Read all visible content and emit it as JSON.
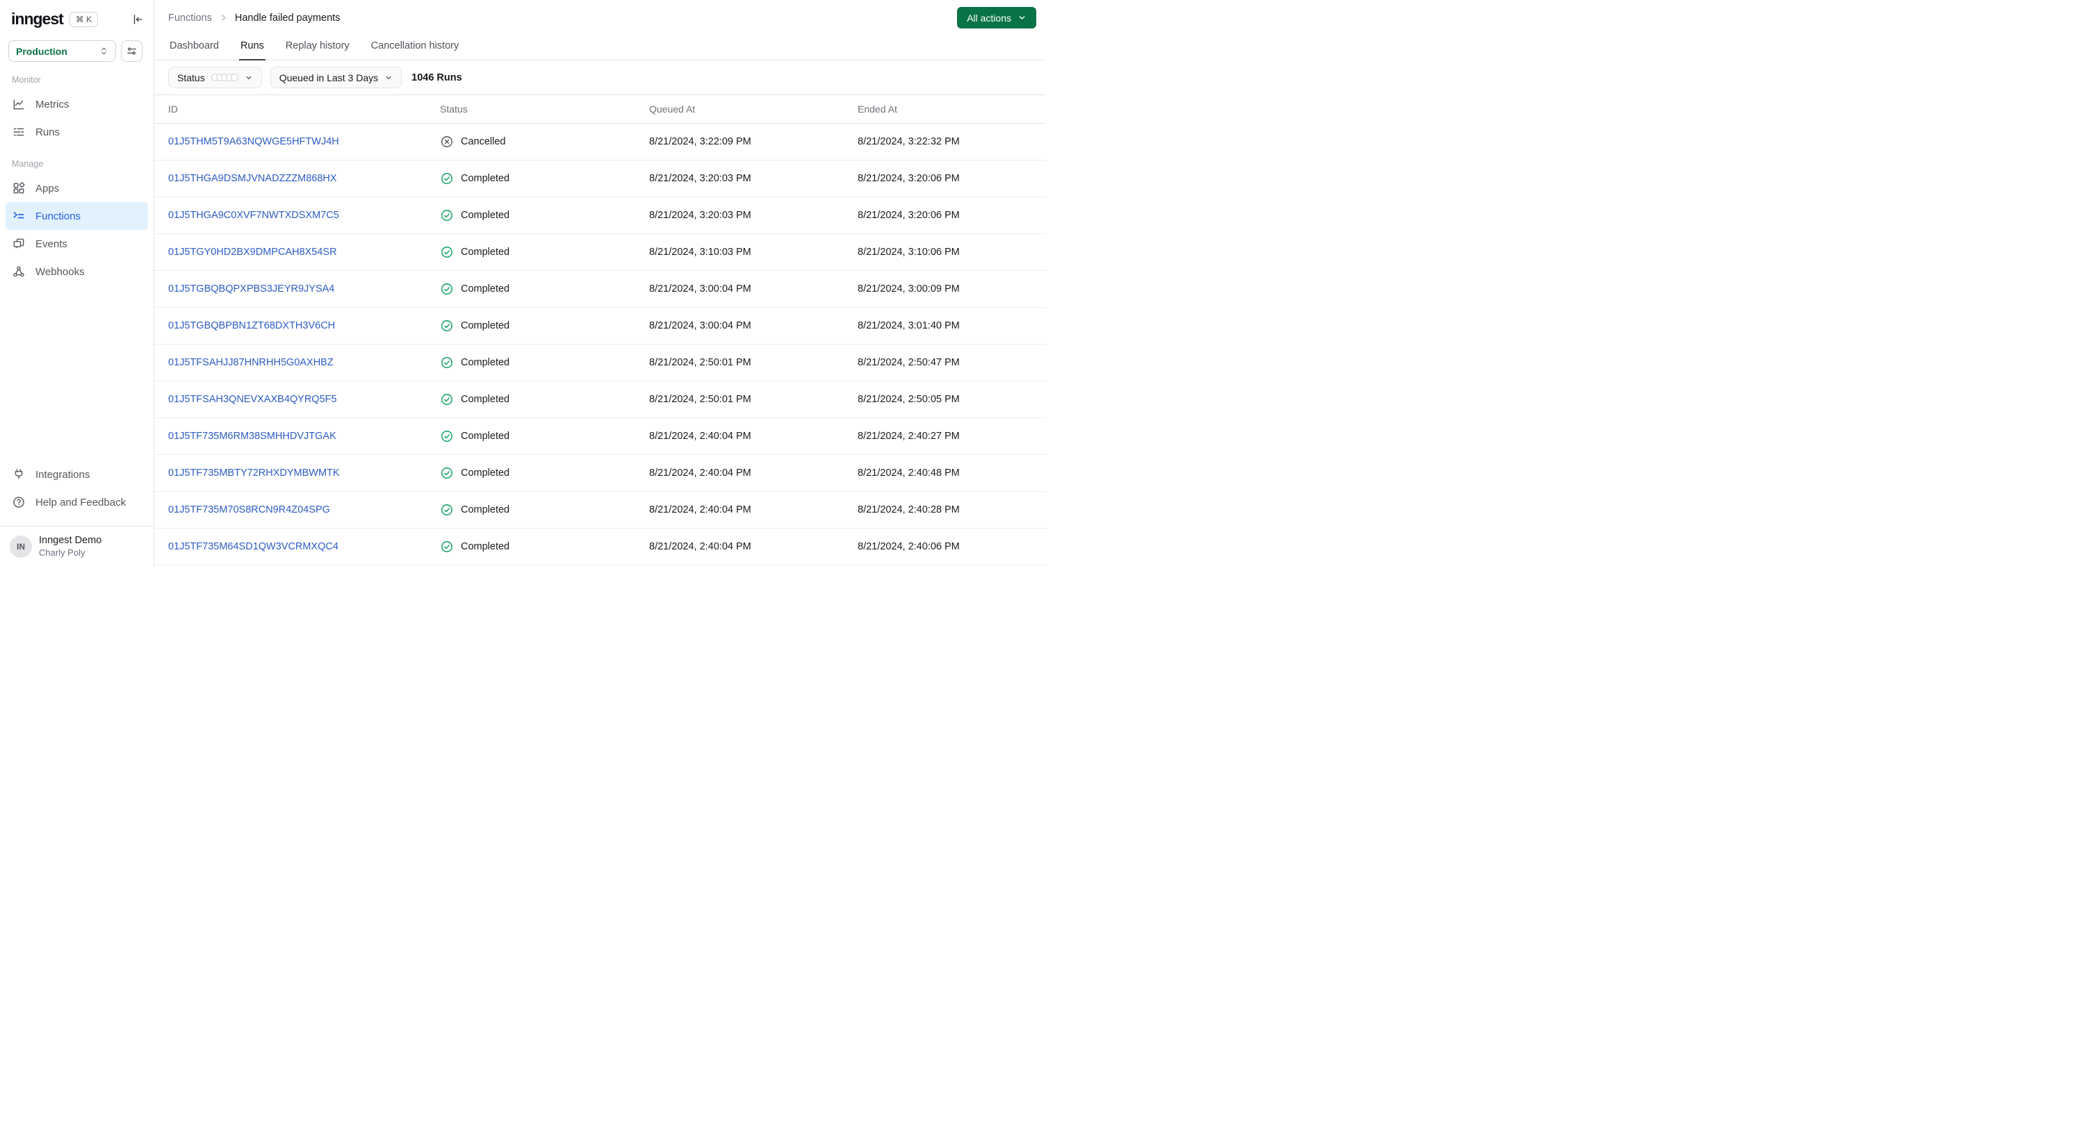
{
  "colors": {
    "accent_green": "#0a7346",
    "completed_green": "#0aa05c",
    "link_blue": "#2c5cc5",
    "active_nav_blue": "#2361dd",
    "active_nav_bg": "#e1f1fe",
    "border": "#e4e4e7"
  },
  "sidebar": {
    "logo": "inngest",
    "shortcut": "⌘ K",
    "collapse_icon": "collapse-sidebar-icon",
    "workspace": {
      "selected": "Production",
      "picker_icon": "updown-chevrons-icon",
      "settings_icon": "preferences-sliders-icon"
    },
    "sections": [
      {
        "label": "Monitor",
        "items": [
          {
            "label": "Metrics",
            "icon": "chart-icon",
            "active": false
          },
          {
            "label": "Runs",
            "icon": "dashed-list-icon",
            "active": false
          }
        ]
      },
      {
        "label": "Manage",
        "items": [
          {
            "label": "Apps",
            "icon": "apps-grid-icon",
            "active": false
          },
          {
            "label": "Functions",
            "icon": "function-list-icon",
            "active": true
          },
          {
            "label": "Events",
            "icon": "windows-icon",
            "active": false
          },
          {
            "label": "Webhooks",
            "icon": "webhook-icon",
            "active": false
          }
        ]
      }
    ],
    "footer_items": [
      {
        "label": "Integrations",
        "icon": "plug-icon"
      },
      {
        "label": "Help and Feedback",
        "icon": "question-circle-icon"
      }
    ],
    "user": {
      "initials": "IN",
      "org": "Inngest Demo",
      "name": "Charly Poly"
    }
  },
  "header": {
    "breadcrumb": {
      "root": "Functions",
      "current": "Handle failed payments"
    },
    "actions_button": "All actions",
    "tabs": [
      {
        "label": "Dashboard",
        "active": false
      },
      {
        "label": "Runs",
        "active": true
      },
      {
        "label": "Replay history",
        "active": false
      },
      {
        "label": "Cancellation history",
        "active": false
      }
    ]
  },
  "filters": {
    "status_label": "Status",
    "time_range": "Queued in Last 3 Days",
    "count": "1046 Runs"
  },
  "table": {
    "columns": [
      "ID",
      "Status",
      "Queued At",
      "Ended At"
    ],
    "rows": [
      {
        "id": "01J5THM5T9A63NQWGE5HFTWJ4H",
        "status": "cancelled",
        "status_label": "Cancelled",
        "queued_at": "8/21/2024, 3:22:09 PM",
        "ended_at": "8/21/2024, 3:22:32 PM"
      },
      {
        "id": "01J5THGA9DSMJVNADZZZM868HX",
        "status": "completed",
        "status_label": "Completed",
        "queued_at": "8/21/2024, 3:20:03 PM",
        "ended_at": "8/21/2024, 3:20:06 PM"
      },
      {
        "id": "01J5THGA9C0XVF7NWTXDSXM7C5",
        "status": "completed",
        "status_label": "Completed",
        "queued_at": "8/21/2024, 3:20:03 PM",
        "ended_at": "8/21/2024, 3:20:06 PM"
      },
      {
        "id": "01J5TGY0HD2BX9DMPCAH8X54SR",
        "status": "completed",
        "status_label": "Completed",
        "queued_at": "8/21/2024, 3:10:03 PM",
        "ended_at": "8/21/2024, 3:10:06 PM"
      },
      {
        "id": "01J5TGBQBQPXPBS3JEYR9JYSA4",
        "status": "completed",
        "status_label": "Completed",
        "queued_at": "8/21/2024, 3:00:04 PM",
        "ended_at": "8/21/2024, 3:00:09 PM"
      },
      {
        "id": "01J5TGBQBPBN1ZT68DXTH3V6CH",
        "status": "completed",
        "status_label": "Completed",
        "queued_at": "8/21/2024, 3:00:04 PM",
        "ended_at": "8/21/2024, 3:01:40 PM"
      },
      {
        "id": "01J5TFSAHJJ87HNRHH5G0AXHBZ",
        "status": "completed",
        "status_label": "Completed",
        "queued_at": "8/21/2024, 2:50:01 PM",
        "ended_at": "8/21/2024, 2:50:47 PM"
      },
      {
        "id": "01J5TFSAH3QNEVXAXB4QYRQ5F5",
        "status": "completed",
        "status_label": "Completed",
        "queued_at": "8/21/2024, 2:50:01 PM",
        "ended_at": "8/21/2024, 2:50:05 PM"
      },
      {
        "id": "01J5TF735M6RM38SMHHDVJTGAK",
        "status": "completed",
        "status_label": "Completed",
        "queued_at": "8/21/2024, 2:40:04 PM",
        "ended_at": "8/21/2024, 2:40:27 PM"
      },
      {
        "id": "01J5TF735MBTY72RHXDYMBWMTK",
        "status": "completed",
        "status_label": "Completed",
        "queued_at": "8/21/2024, 2:40:04 PM",
        "ended_at": "8/21/2024, 2:40:48 PM"
      },
      {
        "id": "01J5TF735M70S8RCN9R4Z04SPG",
        "status": "completed",
        "status_label": "Completed",
        "queued_at": "8/21/2024, 2:40:04 PM",
        "ended_at": "8/21/2024, 2:40:28 PM"
      },
      {
        "id": "01J5TF735M64SD1QW3VCRMXQC4",
        "status": "completed",
        "status_label": "Completed",
        "queued_at": "8/21/2024, 2:40:04 PM",
        "ended_at": "8/21/2024, 2:40:06 PM"
      }
    ]
  }
}
